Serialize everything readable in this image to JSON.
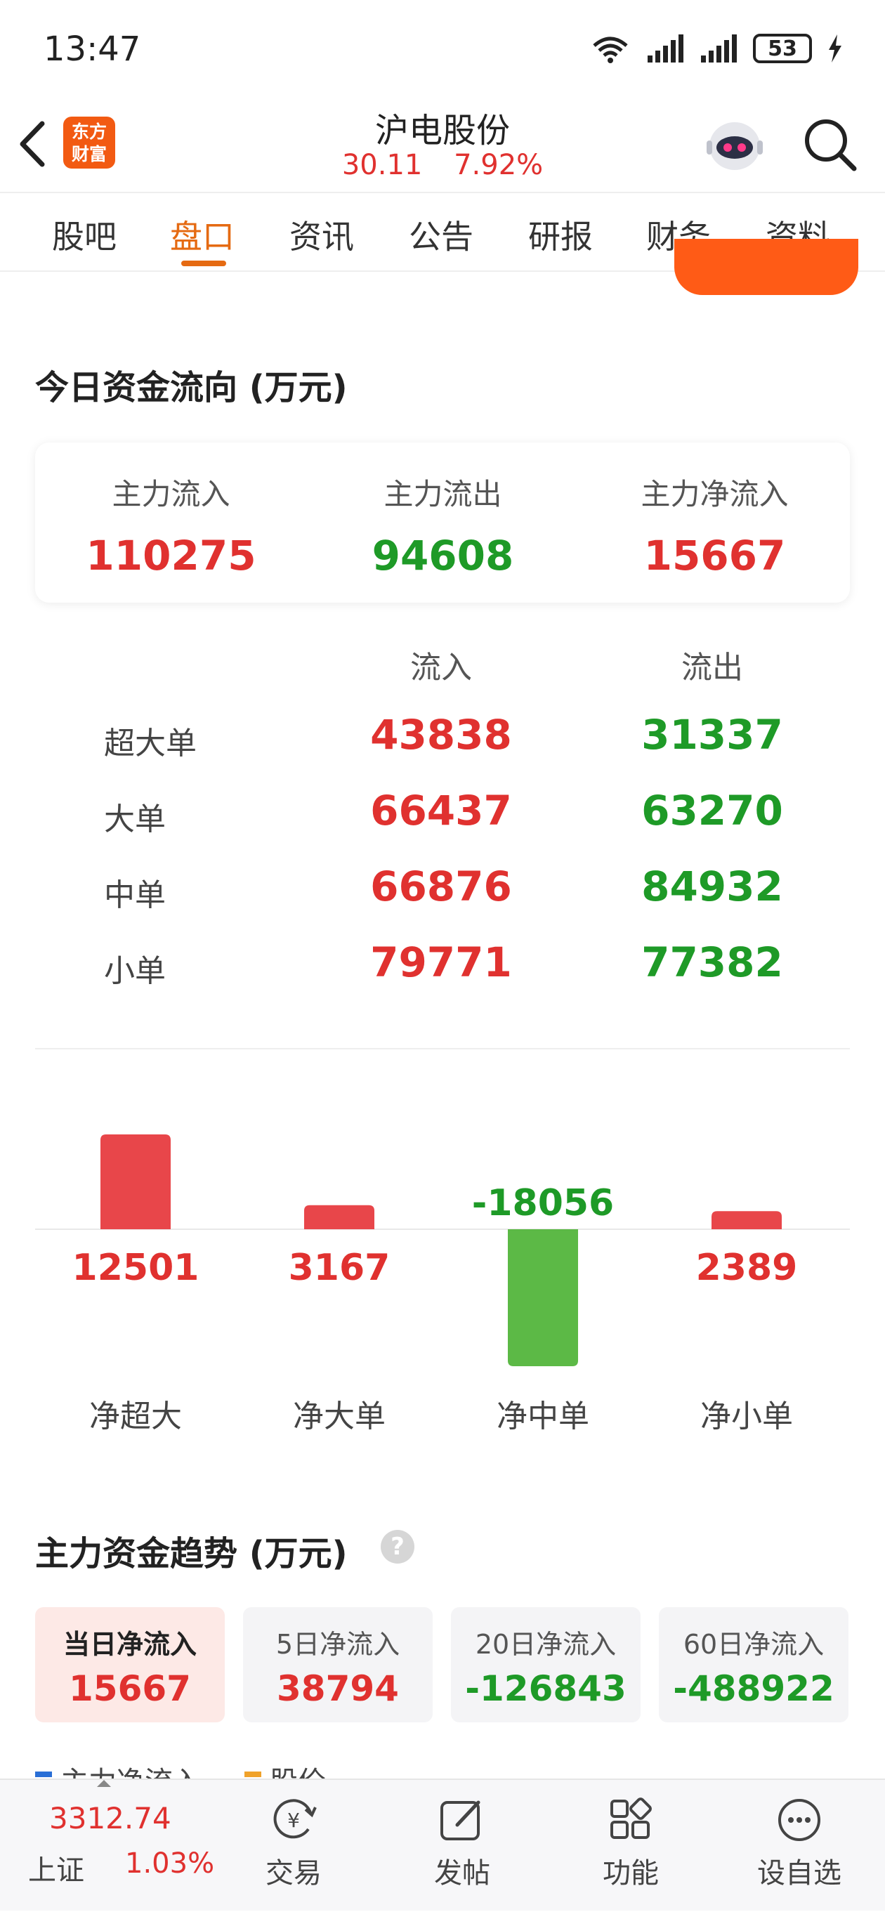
{
  "status_bar": {
    "time": "13:47",
    "battery": "53"
  },
  "header": {
    "stock_name": "沪电股份",
    "price": "30.11",
    "change_pct": "7.92%",
    "logo_line1": "东方",
    "logo_line2": "财富"
  },
  "tabs": [
    {
      "label": "股吧"
    },
    {
      "label": "盘口"
    },
    {
      "label": "资讯"
    },
    {
      "label": "公告"
    },
    {
      "label": "研报"
    },
    {
      "label": "财务"
    },
    {
      "label": "资料"
    }
  ],
  "active_tab": "盘口",
  "capital_flow": {
    "title": "今日资金流向 (万元)",
    "main_inflow_label": "主力流入",
    "main_inflow": "110275",
    "main_outflow_label": "主力流出",
    "main_outflow": "94608",
    "main_net_label": "主力净流入",
    "main_net": "15667"
  },
  "order_table": {
    "col_in": "流入",
    "col_out": "流出",
    "rows": [
      {
        "label": "超大单",
        "in": "43838",
        "out": "31337"
      },
      {
        "label": "大单",
        "in": "66437",
        "out": "63270"
      },
      {
        "label": "中单",
        "in": "66876",
        "out": "84932"
      },
      {
        "label": "小单",
        "in": "79771",
        "out": "77382"
      }
    ]
  },
  "chart_data": {
    "type": "bar",
    "categories": [
      "净超大",
      "净大单",
      "净中单",
      "净小单"
    ],
    "values": [
      12501,
      3167,
      -18056,
      2389
    ],
    "labels": [
      "12501",
      "3167",
      "-18056",
      "2389"
    ],
    "colors": {
      "positive": "#e8464a",
      "negative": "#5cb946"
    }
  },
  "trend": {
    "title": "主力资金趋势 (万元)",
    "boxes": [
      {
        "label": "当日净流入",
        "value": "15667",
        "sign": "pos"
      },
      {
        "label": "5日净流入",
        "value": "38794",
        "sign": "pos"
      },
      {
        "label": "20日净流入",
        "value": "-126843",
        "sign": "neg"
      },
      {
        "label": "60日净流入",
        "value": "-488922",
        "sign": "neg"
      }
    ],
    "legend": [
      "主力净流入",
      "股价"
    ]
  },
  "bottom_nav": {
    "index_value": "3312.74",
    "index_name": "上证",
    "index_change": "1.03%",
    "items": [
      {
        "label": "交易",
        "icon": "trade-icon"
      },
      {
        "label": "发帖",
        "icon": "post-icon"
      },
      {
        "label": "功能",
        "icon": "functions-icon"
      },
      {
        "label": "设自选",
        "icon": "add-watchlist-icon"
      }
    ]
  },
  "colors": {
    "up": "#e0312f",
    "down": "#1e9a27",
    "accent": "#e56a12"
  }
}
